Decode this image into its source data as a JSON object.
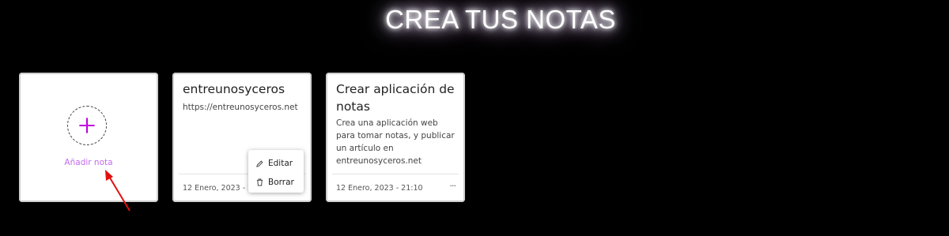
{
  "header": {
    "title": "CREA TUS NOTAS"
  },
  "add_card": {
    "label": "Añadir nota",
    "icon": "plus-icon",
    "accent": "#c36bf0"
  },
  "notes": [
    {
      "title": "entreunosyceros",
      "description": "https://entreunosyceros.net",
      "date": "12 Enero, 2023 - 22"
    },
    {
      "title": "Crear aplicación de notas",
      "description": "Crea una aplicación web para tomar notas, y publicar un artículo en entreunosyceros.net",
      "date": "12 Enero, 2023 - 21:10",
      "more": "···"
    }
  ],
  "menu": {
    "items": [
      {
        "label": "Editar",
        "icon": "pencil-icon"
      },
      {
        "label": "Borrar",
        "icon": "trash-icon"
      }
    ]
  },
  "annotation": {
    "arrow_color": "#e01010"
  }
}
